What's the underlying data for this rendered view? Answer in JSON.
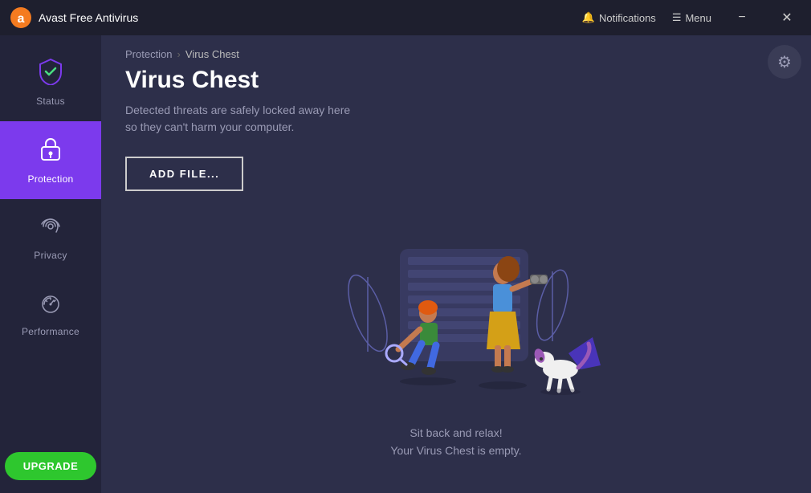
{
  "titlebar": {
    "app_name": "Avast Free Antivirus",
    "notifications_label": "Notifications",
    "menu_label": "Menu",
    "minimize_label": "−",
    "close_label": "✕"
  },
  "sidebar": {
    "items": [
      {
        "id": "status",
        "label": "Status",
        "icon": "shield",
        "active": false
      },
      {
        "id": "protection",
        "label": "Protection",
        "icon": "lock",
        "active": true
      },
      {
        "id": "privacy",
        "label": "Privacy",
        "icon": "fingerprint",
        "active": false
      },
      {
        "id": "performance",
        "label": "Performance",
        "icon": "speedometer",
        "active": false
      }
    ],
    "upgrade_label": "UPGRADE"
  },
  "breadcrumb": {
    "parent": "Protection",
    "separator": "›",
    "current": "Virus Chest"
  },
  "page": {
    "title": "Virus Chest",
    "description_line1": "Detected threats are safely locked away here",
    "description_line2": "so they can't harm your computer.",
    "add_file_label": "ADD FILE...",
    "empty_line1": "Sit back and relax!",
    "empty_line2": "Your Virus Chest is empty."
  },
  "gear": {
    "label": "⚙"
  }
}
